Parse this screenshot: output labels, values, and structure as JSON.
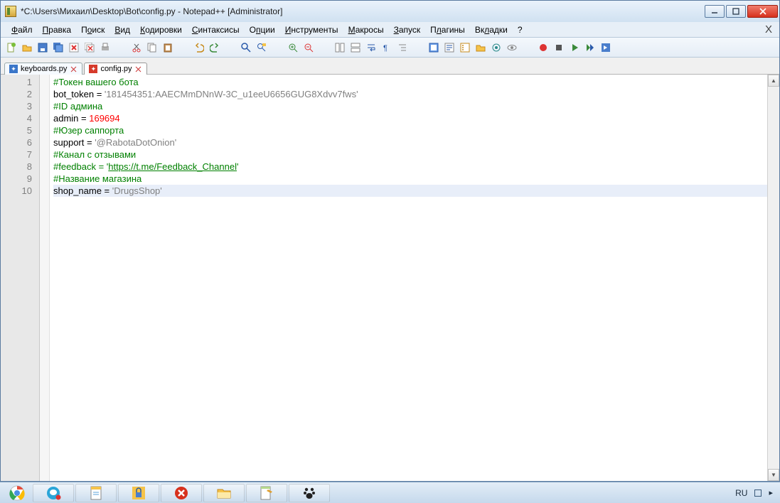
{
  "title": "*C:\\Users\\Михаил\\Desktop\\Bot\\config.py - Notepad++ [Administrator]",
  "menu": {
    "file": "Файл",
    "edit": "Правка",
    "search": "Поиск",
    "view": "Вид",
    "encoding": "Кодировки",
    "syntax": "Синтаксисы",
    "options": "Опции",
    "tools": "Инструменты",
    "macros": "Макросы",
    "run": "Запуск",
    "plugins": "Плагины",
    "tabs": "Вкладки",
    "help": "?",
    "close_x": "X"
  },
  "tabs": {
    "t1": "keyboards.py",
    "t2": "config.py"
  },
  "gutter": {
    "l1": "1",
    "l2": "2",
    "l3": "3",
    "l4": "4",
    "l5": "5",
    "l6": "6",
    "l7": "7",
    "l8": "8",
    "l9": "9",
    "l10": "10"
  },
  "code": {
    "l1": "#Токен вашего бота",
    "l2a": "bot_token = ",
    "l2b": "'181454351:AAECMmDNnW-3C_u1eeU6656GUG8Xdvv7fws'",
    "l3": "#ID админа",
    "l4a": "admin = ",
    "l4b": "169694",
    "l5": "#Юзер саппорта",
    "l6a": "support = ",
    "l6b": "'@RabotaDotOnion'",
    "l7": "#Канал с отзывами",
    "l8a": "#feedback = '",
    "l8b": "https://t.me/Feedback_Channel",
    "l8c": "'",
    "l9": "#Название магазина",
    "l10a": "shop_name = ",
    "l10b": "'DrugsShop'"
  },
  "tray": {
    "lang": "RU"
  }
}
